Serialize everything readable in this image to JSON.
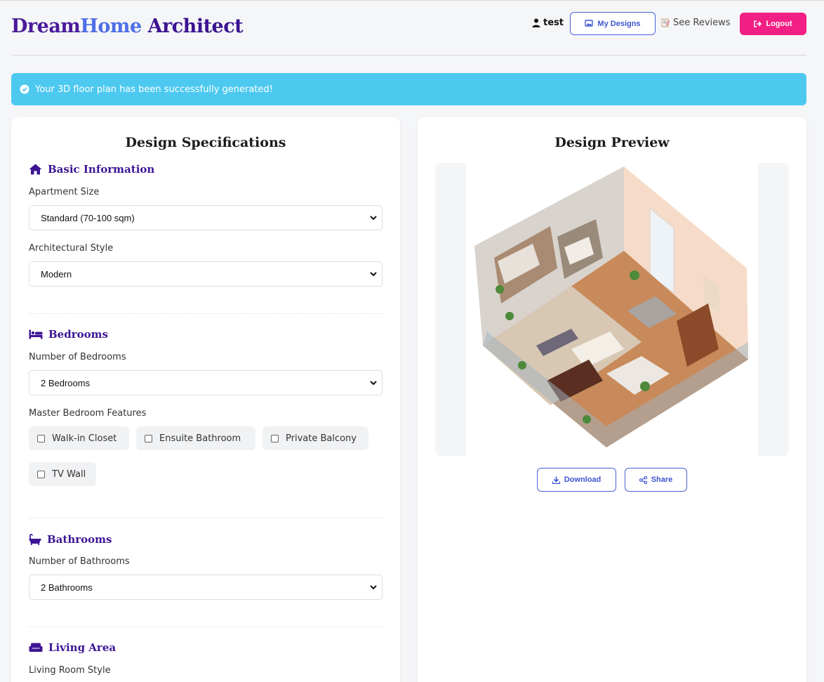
{
  "header": {
    "brand_part1": "Dream",
    "brand_part2": "Home",
    "brand_part3": " Architect",
    "username": "test",
    "my_designs": "My Designs",
    "see_reviews": "See Reviews",
    "logout": "Logout"
  },
  "alert": {
    "message": "Your 3D floor plan has been successfully generated!"
  },
  "specs": {
    "title": "Design Specifications",
    "basic": {
      "heading": "Basic Information",
      "size_label": "Apartment Size",
      "size_value": "Standard (70-100 sqm)",
      "style_label": "Architectural Style",
      "style_value": "Modern"
    },
    "bedrooms": {
      "heading": "Bedrooms",
      "count_label": "Number of Bedrooms",
      "count_value": "2 Bedrooms",
      "features_label": "Master Bedroom Features",
      "features": [
        "Walk-in Closet",
        "Ensuite Bathroom",
        "Private Balcony",
        "TV Wall"
      ]
    },
    "bathrooms": {
      "heading": "Bathrooms",
      "count_label": "Number of Bathrooms",
      "count_value": "2 Bathrooms"
    },
    "living": {
      "heading": "Living Area",
      "style_label": "Living Room Style"
    }
  },
  "preview": {
    "title": "Design Preview",
    "download": "Download",
    "share": "Share"
  },
  "colors": {
    "brand_purple": "#3b1390",
    "brand_blue": "#4e6fe6",
    "accent_pink": "#f21f84",
    "alert_bg": "#4dc9f0",
    "outline_blue": "#4a62d8"
  }
}
